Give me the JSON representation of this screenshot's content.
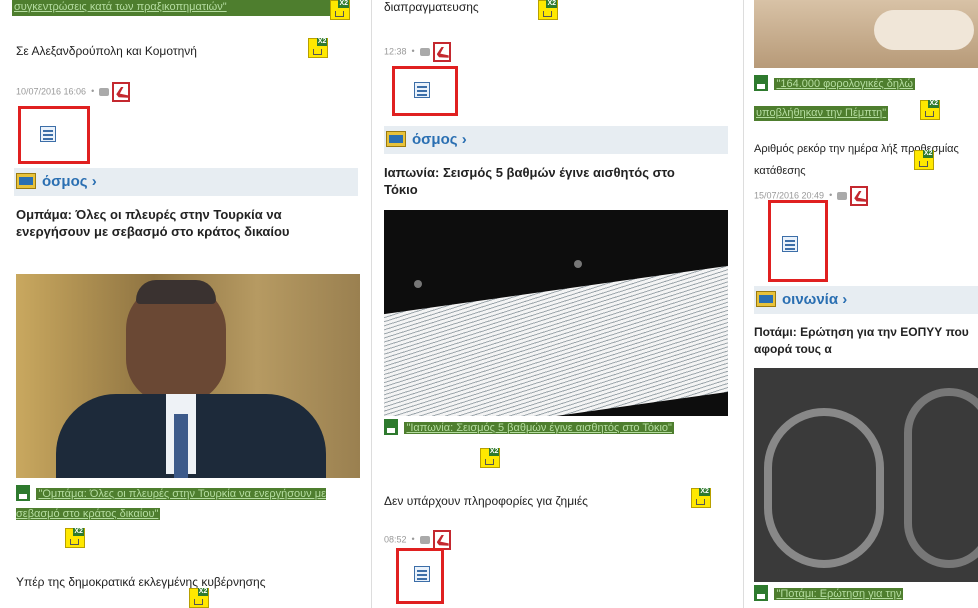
{
  "col1": {
    "top_banner": "συγκεντρώσεις κατά των πραξικοπηματιών\"",
    "headline1": "Σε Αλεξανδρούπολη και Κομοτηνή",
    "meta1_time": "10/07/2016 16:06",
    "section": "όσμος ›",
    "article_title": "Ομπάμα: Όλες οι πλευρές στην Τουρκία να ενεργήσουν με σεβασμό στο κράτος δικαίου",
    "alt_label": "alt",
    "caption": "\"Ομπάμα: Όλες οι πλευρές στην Τουρκία να ενεργήσουν με σεβασμό στο κράτος δικαίου\"",
    "body_text": "Υπέρ της δημοκρατικά εκλεγμένης κυβέρνησης"
  },
  "col2": {
    "top_text": "διαπραγματευσης",
    "meta_top_time": "12:38",
    "section": "όσμος ›",
    "article_title": "Ιαπωνία: Σεισμός 5 βαθμών έγινε αισθητός στο Τόκιο",
    "alt_label": "alt",
    "caption": "\"Ιαπωνία: Σεισμός 5 βαθμών έγινε αισθητός στο Τόκιο\"",
    "body_text": "Δεν υπάρχουν πληροφορίες για ζημιές",
    "meta_bottom_time": "08:52"
  },
  "col3": {
    "alt_label": "alt",
    "caption1": "\"164.000 φορολογικές δηλώ",
    "caption1b": "υποβλήθηκαν την Πέμπτη\"",
    "body_text": "Αριθμός ρεκόρ την ημέρα λήξ προθεσμίας κατάθεσης",
    "meta_time": "15/07/2016 20:49",
    "section": "οινωνία ›",
    "article_title": "Ποτάμι: Ερώτηση για την ΕΟΠΥΥ που αφορά τους α",
    "caption2": "\"Ποτάμι: Ερώτηση για την"
  },
  "x2_badge": "X2",
  "comment_bubble": "comment-icon",
  "colors": {
    "accent_blue": "#2a6fb2",
    "red_highlight": "#e02020",
    "alt_green": "#4e7e2e"
  }
}
